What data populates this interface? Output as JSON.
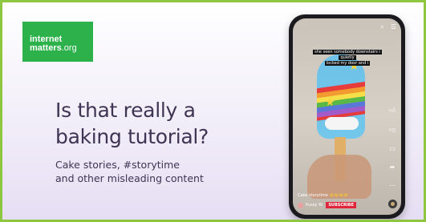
{
  "brand": {
    "line1": "internet",
    "line2_bold": "matters",
    "line2_suffix": ".org",
    "color": "#2db14a"
  },
  "headline": {
    "line1": "Is that really a",
    "line2": "baking tutorial?"
  },
  "subhead": {
    "line1": "Cake stories, #storytime",
    "line2": "and other misleading content"
  },
  "phone": {
    "caption_lines": [
      "she seen somebody downstairs i",
      "quietly",
      "locked my door and i"
    ],
    "video_caption": "Cake storytime",
    "emoji_text": "😂😂😂😂",
    "username": "Pussy Yo",
    "subscribe_label": "SUBSCRIBE",
    "top_icons": [
      "search-icon",
      "menu-icon"
    ],
    "side_icons": [
      "like-icon",
      "dislike-icon",
      "comment-icon",
      "share-icon",
      "more-icon"
    ]
  },
  "colors": {
    "frame_border": "#8ec63f",
    "text": "#3d3553",
    "subscribe": "#e0263b"
  }
}
